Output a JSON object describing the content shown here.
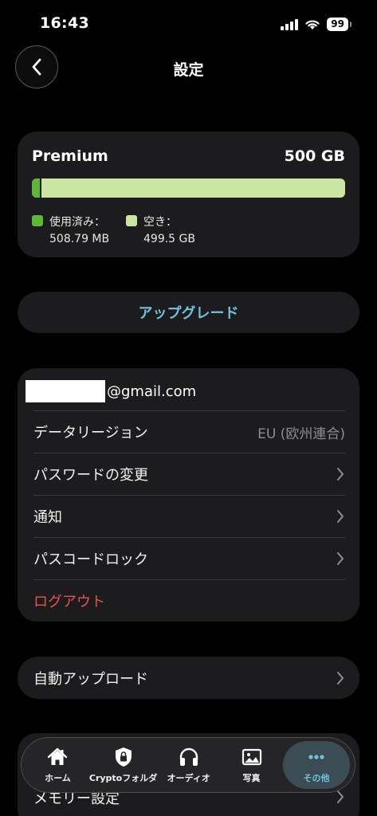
{
  "status": {
    "time": "16:43",
    "battery": "99"
  },
  "header": {
    "title": "設定"
  },
  "storage": {
    "plan": "Premium",
    "total": "500 GB",
    "used_fraction": 0.03,
    "used_label": "使用済み：",
    "used_value": "508.79 MB",
    "free_label": "空き：",
    "free_value": "499.5 GB",
    "colors": {
      "used": "#5db836",
      "free": "#cbe6a0"
    }
  },
  "upgrade": {
    "label": "アップグレード"
  },
  "account": {
    "email_domain": "@gmail.com",
    "rows": [
      {
        "label": "データリージョン",
        "value": "EU (欧州連合)"
      },
      {
        "label": "パスワードの変更"
      },
      {
        "label": "通知"
      },
      {
        "label": "パスコードロック"
      },
      {
        "label": "ログアウト"
      }
    ]
  },
  "auto_upload": {
    "label": "自動アップロード"
  },
  "memory": {
    "label": "メモリー設定"
  },
  "tabbar": {
    "tabs": [
      {
        "label": "ホーム",
        "icon": "home-icon"
      },
      {
        "label": "Cryptoフォルダ",
        "icon": "shield-lock-icon"
      },
      {
        "label": "オーディオ",
        "icon": "headphones-icon"
      },
      {
        "label": "写真",
        "icon": "photo-icon"
      },
      {
        "label": "その他",
        "icon": "more-icon"
      }
    ],
    "active": "その他",
    "accent": "#6ec3de"
  }
}
